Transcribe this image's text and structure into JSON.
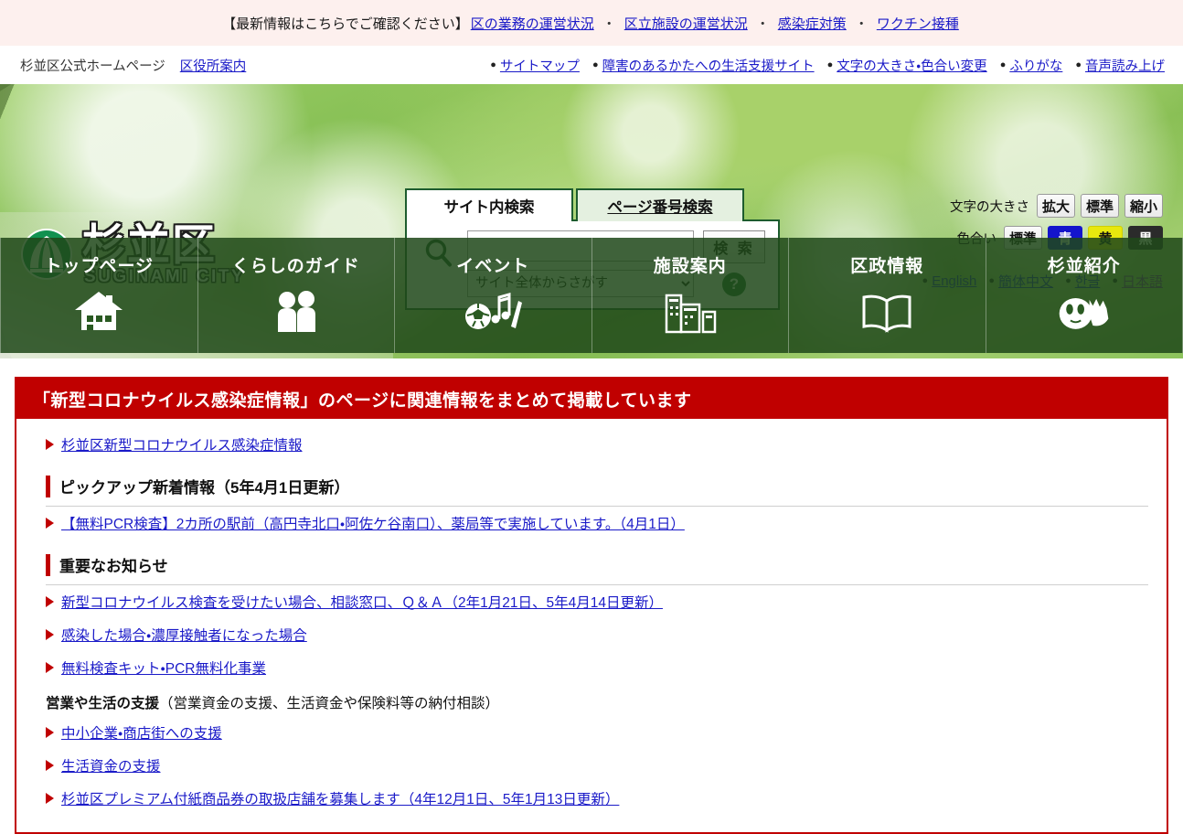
{
  "emergency": {
    "lead": "【最新情報はこちらでご確認ください】",
    "links": [
      "区の業務の運営状況",
      "区立施設の運営状況",
      "感染症対策",
      "ワクチン接種"
    ],
    "separator": "・"
  },
  "utility": {
    "site_name": "杉並区公式ホームページ",
    "office_guide": "区役所案内",
    "links": [
      "サイトマップ",
      "障害のあるかたへの生活支援サイト",
      "文字の大きさ・色合い変更",
      "ふりがな",
      "音声読み上げ"
    ]
  },
  "logo": {
    "kanji": "杉並区",
    "roman": "SUGINAMI CITY",
    "mark": "suginami-emblem-icon"
  },
  "search": {
    "tab_site": "サイト内検索",
    "tab_page_number": "ページ番号検索",
    "input_value": "",
    "input_placeholder": "",
    "scope_selected": "サイト全体からさがす",
    "scope_options": [
      "サイト全体からさがす"
    ],
    "button_label": "検 索",
    "help_label": "?",
    "magnifier": "search-icon"
  },
  "accessibility": {
    "text_size_label": "文字の大きさ",
    "text_size_buttons": [
      "拡大",
      "標準",
      "縮小"
    ],
    "color_label": "色合い",
    "color_buttons": [
      "標準",
      "青",
      "黄",
      "黒"
    ],
    "colors": {
      "blue": "#1414cc",
      "yellow": "#e8e80e",
      "black": "#2b2b2b"
    }
  },
  "languages": [
    {
      "label": "English",
      "visited": false
    },
    {
      "label": "簡体中文",
      "visited": false
    },
    {
      "label": "한글",
      "visited": false
    },
    {
      "label": "日本語",
      "visited": true
    }
  ],
  "global_nav": [
    {
      "label": "トップページ",
      "icon": "house-icon"
    },
    {
      "label": "くらしのガイド",
      "icon": "two-people-icon"
    },
    {
      "label": "イベント",
      "icon": "soccer-music-pencil-icon"
    },
    {
      "label": "施設案内",
      "icon": "buildings-icon"
    },
    {
      "label": "区政情報",
      "icon": "open-book-icon"
    },
    {
      "label": "杉並紹介",
      "icon": "mascot-icon"
    }
  ],
  "main": {
    "banner_title": "「新型コロナウイルス感染症情報」のページに関連情報をまとめて掲載しています",
    "banner_color": "#c00000",
    "top_link": "杉並区新型コロナウイルス感染症情報",
    "section_pickup": {
      "title": "ピックアップ新着情報（5年4月1日更新）",
      "links": [
        "【無料PCR検査】2カ所の駅前（高円寺北口・阿佐ケ谷南口）、薬局等で実施しています。（4月1日）"
      ]
    },
    "section_important": {
      "title": "重要なお知らせ",
      "links": [
        "新型コロナウイルス検査を受けたい場合、相談窓口、Ｑ＆Ａ（2年1月21日、5年4月14日更新）",
        "感染した場合・濃厚接触者になった場合",
        "無料検査キット・PCR無料化事業"
      ],
      "subhead_bold": "営業や生活の支援",
      "subhead_rest": "（営業資金の支援、生活資金や保険料等の納付相談）",
      "support_links": [
        "中小企業・商店街への支援",
        "生活資金の支援",
        "杉並区プレミアム付紙商品券の取扱店舗を募集します（4年12月1日、5年1月13日更新）"
      ]
    }
  }
}
